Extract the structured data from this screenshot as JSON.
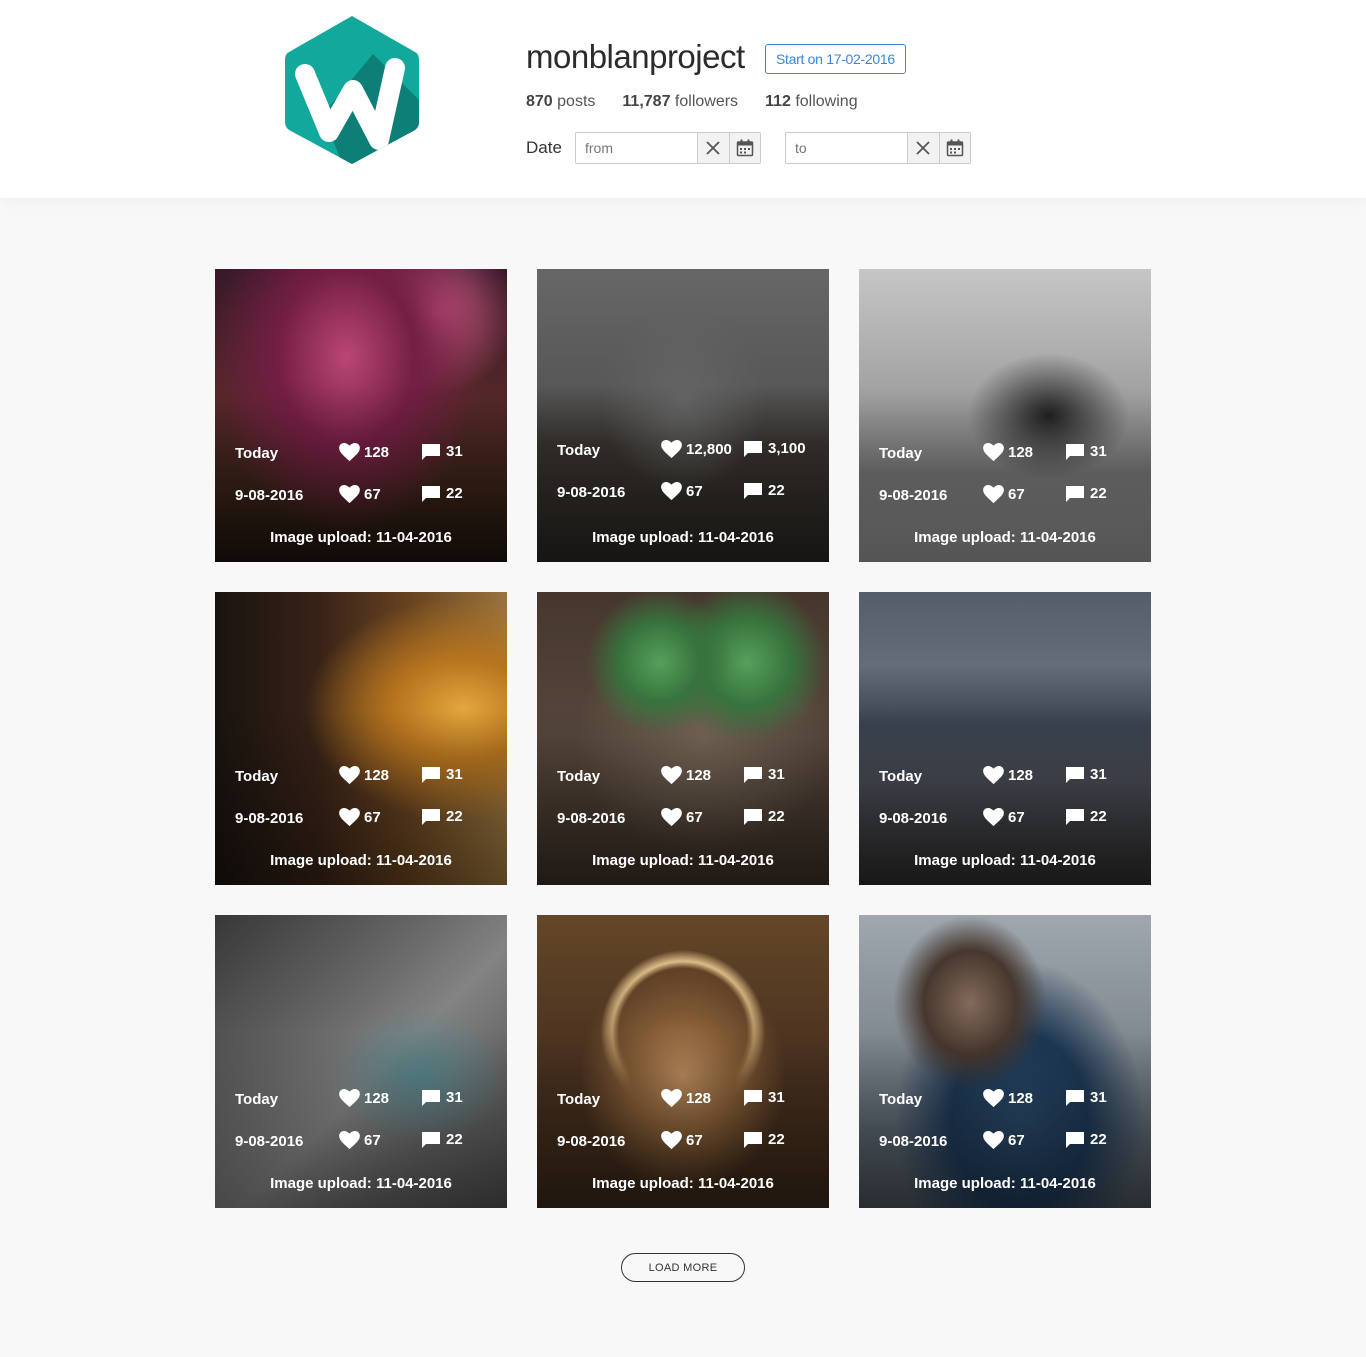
{
  "profile": {
    "username": "monblanproject",
    "start_badge": "Start on 17-02-2016",
    "posts_count": "870",
    "posts_label": "posts",
    "followers_count": "11,787",
    "followers_label": "followers",
    "following_count": "112",
    "following_label": "following",
    "brand_color": "#0f9e94"
  },
  "filter": {
    "date_label": "Date",
    "from_placeholder": "from",
    "to_placeholder": "to"
  },
  "posts": [
    {
      "today_label": "Today",
      "today_likes": "128",
      "today_comments": "31",
      "date": "9-08-2016",
      "date_likes": "67",
      "date_comments": "22",
      "upload": "Image upload: 11-04-2016"
    },
    {
      "today_label": "Today",
      "today_likes": "12,800",
      "today_comments": "3,100",
      "date": "9-08-2016",
      "date_likes": "67",
      "date_comments": "22",
      "upload": "Image upload: 11-04-2016"
    },
    {
      "today_label": "Today",
      "today_likes": "128",
      "today_comments": "31",
      "date": "9-08-2016",
      "date_likes": "67",
      "date_comments": "22",
      "upload": "Image upload: 11-04-2016"
    },
    {
      "today_label": "Today",
      "today_likes": "128",
      "today_comments": "31",
      "date": "9-08-2016",
      "date_likes": "67",
      "date_comments": "22",
      "upload": "Image upload: 11-04-2016"
    },
    {
      "today_label": "Today",
      "today_likes": "128",
      "today_comments": "31",
      "date": "9-08-2016",
      "date_likes": "67",
      "date_comments": "22",
      "upload": "Image upload: 11-04-2016"
    },
    {
      "today_label": "Today",
      "today_likes": "128",
      "today_comments": "31",
      "date": "9-08-2016",
      "date_likes": "67",
      "date_comments": "22",
      "upload": "Image upload: 11-04-2016"
    },
    {
      "today_label": "Today",
      "today_likes": "128",
      "today_comments": "31",
      "date": "9-08-2016",
      "date_likes": "67",
      "date_comments": "22",
      "upload": "Image upload: 11-04-2016"
    },
    {
      "today_label": "Today",
      "today_likes": "128",
      "today_comments": "31",
      "date": "9-08-2016",
      "date_likes": "67",
      "date_comments": "22",
      "upload": "Image upload: 11-04-2016"
    },
    {
      "today_label": "Today",
      "today_likes": "128",
      "today_comments": "31",
      "date": "9-08-2016",
      "date_likes": "67",
      "date_comments": "22",
      "upload": "Image upload: 11-04-2016"
    }
  ],
  "load_more_label": "LOAD MORE",
  "icons": {
    "clear": "close-icon",
    "calendar": "calendar-icon",
    "like": "heart-icon",
    "comment": "comment-icon"
  }
}
